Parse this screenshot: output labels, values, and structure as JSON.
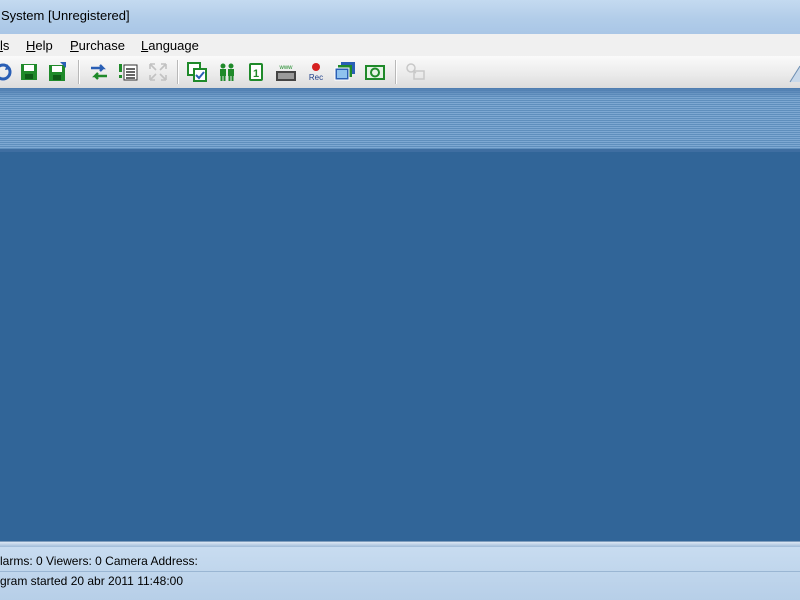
{
  "window": {
    "title": "System [Unregistered]"
  },
  "menu": [
    {
      "id": "tools",
      "label": "ls",
      "underline": "l"
    },
    {
      "id": "help",
      "label": "Help",
      "underline": "H"
    },
    {
      "id": "purchase",
      "label": "Purchase",
      "underline": "P"
    },
    {
      "id": "language",
      "label": "Language",
      "underline": "L"
    }
  ],
  "toolbar": {
    "buttons": [
      {
        "name": "refresh-icon",
        "enabled": true
      },
      {
        "name": "save-icon",
        "enabled": true
      },
      {
        "name": "save-as-icon",
        "enabled": true
      },
      {
        "name": "swap-icon",
        "enabled": true
      },
      {
        "name": "list-icon",
        "enabled": true
      },
      {
        "name": "fullscreen-icon",
        "enabled": false
      },
      {
        "name": "select-camera-icon",
        "enabled": true
      },
      {
        "name": "viewers-icon",
        "enabled": true
      },
      {
        "name": "single-view-icon",
        "enabled": true
      },
      {
        "name": "www-icon",
        "label": "www",
        "enabled": true
      },
      {
        "name": "record-icon",
        "label": "Rec",
        "enabled": true
      },
      {
        "name": "multi-view-icon",
        "enabled": true
      },
      {
        "name": "snapshot-icon",
        "enabled": true
      },
      {
        "name": "network-icon",
        "enabled": false
      }
    ]
  },
  "status": {
    "line1": "larms:  0  Viewers:  0  Camera Address:",
    "line2": "gram started  20 abr 2011 11:48:00"
  },
  "colors": {
    "main_background": "#316598",
    "icon_green": "#1f8a2a",
    "icon_blue": "#2a5fb5",
    "record_red": "#d62020"
  }
}
